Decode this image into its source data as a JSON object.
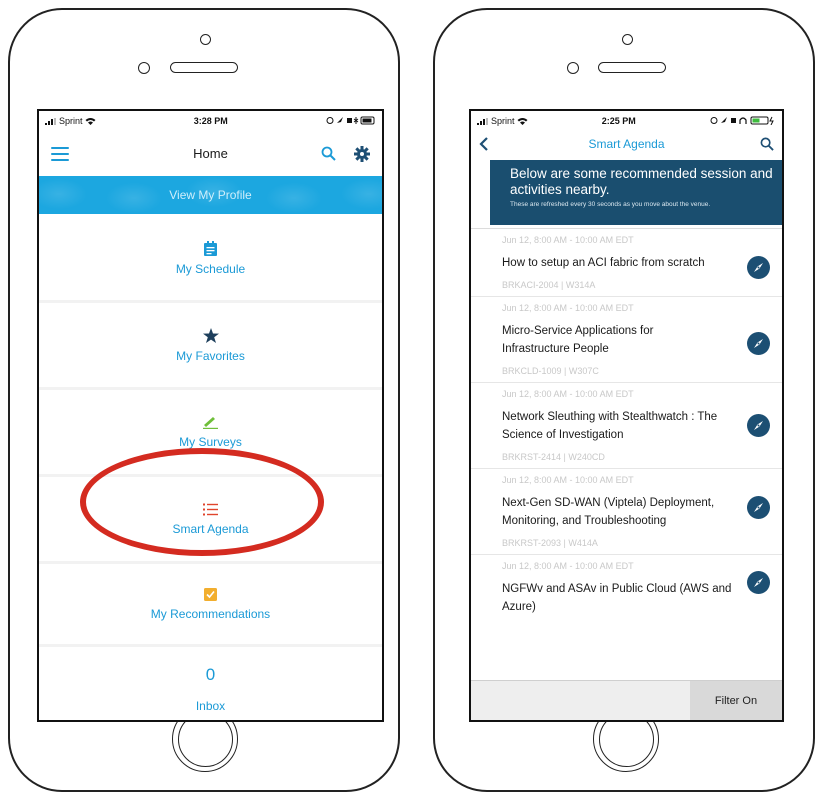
{
  "left_phone": {
    "status": {
      "carrier": "Sprint",
      "time": "3:28 PM"
    },
    "header": {
      "title": "Home",
      "menu_icon": "hamburger-icon",
      "search_icon": "search-icon",
      "settings_icon": "gear-icon"
    },
    "profile_banner": "View My Profile",
    "menu": [
      {
        "label": "My Schedule",
        "icon": "calendar-icon"
      },
      {
        "label": "My Favorites",
        "icon": "star-icon"
      },
      {
        "label": "My Surveys",
        "icon": "pencil-icon"
      },
      {
        "label": "Smart Agenda",
        "icon": "list-icon"
      },
      {
        "label": "My Recommendations",
        "icon": "checkmark-icon"
      },
      {
        "label": "Inbox",
        "count": "0"
      }
    ]
  },
  "right_phone": {
    "status": {
      "carrier": "Sprint",
      "time": "2:25 PM"
    },
    "header": {
      "title": "Smart Agenda",
      "back_icon": "chevron-left-icon",
      "search_icon": "search-icon"
    },
    "tooltip": {
      "headline": "Below are some recommended session and activities nearby.",
      "subtext": "These are refreshed every 30 seconds as you move about the venue."
    },
    "sessions": [
      {
        "time": "Jun 12, 8:00 AM - 10:00 AM EDT",
        "title": "How to setup an ACI fabric from scratch",
        "code": "BRKACI-2004 | W314A"
      },
      {
        "time": "Jun 12, 8:00 AM - 10:00 AM EDT",
        "title": "Micro-Service Applications for Infrastructure People",
        "code": "BRKCLD-1009 | W307C"
      },
      {
        "time": "Jun 12, 8:00 AM - 10:00 AM EDT",
        "title": "Network Sleuthing with Stealthwatch : The Science of Investigation",
        "code": "BRKRST-2414 | W240CD"
      },
      {
        "time": "Jun 12, 8:00 AM - 10:00 AM EDT",
        "title": "Next-Gen SD-WAN (Viptela) Deployment, Monitoring, and Troubleshooting",
        "code": "BRKRST-2093 | W414A"
      },
      {
        "time": "Jun 12, 8:00 AM - 10:00 AM EDT",
        "title": "NGFWv and ASAv in Public Cloud (AWS and Azure)",
        "code": ""
      }
    ],
    "filter_button": "Filter On"
  },
  "colors": {
    "accent": "#1b9ad6",
    "banner": "#1ca7e0",
    "tooltip": "#1a4e6f",
    "annotation": "#d42b20"
  }
}
